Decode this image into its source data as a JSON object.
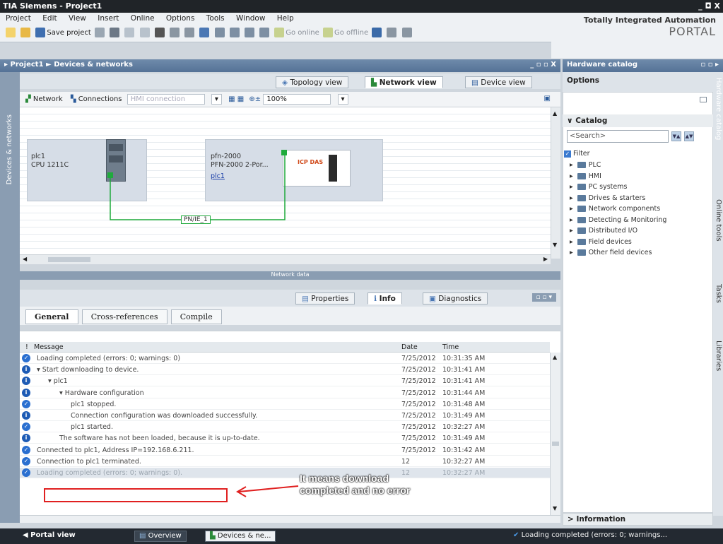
{
  "window": {
    "title": "Siemens - Project1",
    "controls": "_ ◘ X"
  },
  "menu": [
    "Project",
    "Edit",
    "View",
    "Insert",
    "Online",
    "Options",
    "Tools",
    "Window",
    "Help"
  ],
  "toolbar": {
    "save_label": "Save project",
    "go_online": "Go online",
    "go_offline": "Go offline"
  },
  "brand": {
    "line1": "Totally Integrated Automation",
    "line2": "PORTAL"
  },
  "breadcrumb": {
    "project": "Project1",
    "separator": "►",
    "section": "Devices & networks"
  },
  "left_strip_label": "Devices & networks",
  "view_tabs": {
    "topology": "Topology view",
    "network": "Network view",
    "device": "Device view"
  },
  "net_toolbar": {
    "network": "Network",
    "connections": "Connections",
    "hmi_connection": "HMI connection",
    "zoom": "100%"
  },
  "devices": {
    "plc": {
      "name": "plc1",
      "type": "CPU 1211C"
    },
    "pfn": {
      "name": "pfn-2000",
      "type": "PFN-2000 2-Por...",
      "link": "plc1",
      "logo": "ICP DAS"
    },
    "subnet": "PN/IE_1"
  },
  "network_data_label": "Network data",
  "info_tabs": {
    "properties": "Properties",
    "info": "Info",
    "diagnostics": "Diagnostics"
  },
  "sub_tabs": {
    "general": "General",
    "crossref": "Cross-references",
    "compile": "Compile"
  },
  "messages": {
    "headers": {
      "message": "Message",
      "date": "Date",
      "time": "Time"
    },
    "rows": [
      {
        "icon": "check",
        "indent": 0,
        "text": "Loading completed (errors: 0; warnings: 0)",
        "date": "7/25/2012",
        "time": "10:31:35 AM"
      },
      {
        "icon": "info",
        "indent": 0,
        "text": "▾ Start downloading to device.",
        "date": "7/25/2012",
        "time": "10:31:41 AM"
      },
      {
        "icon": "info",
        "indent": 1,
        "text": "▾ plc1",
        "date": "7/25/2012",
        "time": "10:31:41 AM"
      },
      {
        "icon": "info",
        "indent": 2,
        "text": "▾ Hardware configuration",
        "date": "7/25/2012",
        "time": "10:31:44 AM"
      },
      {
        "icon": "check",
        "indent": 3,
        "text": "plc1 stopped.",
        "date": "7/25/2012",
        "time": "10:31:48 AM"
      },
      {
        "icon": "info",
        "indent": 3,
        "text": "Connection configuration was downloaded successfully.",
        "date": "7/25/2012",
        "time": "10:31:49 AM"
      },
      {
        "icon": "check",
        "indent": 3,
        "text": "plc1 started.",
        "date": "7/25/2012",
        "time": "10:32:27 AM"
      },
      {
        "icon": "info",
        "indent": 2,
        "text": "The software has not been loaded, because it is up-to-date.",
        "date": "7/25/2012",
        "time": "10:31:49 AM"
      },
      {
        "icon": "check",
        "indent": 0,
        "text": "Connected to plc1, Address IP=192.168.6.211.",
        "date": "7/25/2012",
        "time": "10:31:42 AM"
      },
      {
        "icon": "check",
        "indent": 0,
        "text": "Connection to plc1 terminated.",
        "date": "12",
        "time": "10:32:27 AM"
      },
      {
        "icon": "check",
        "indent": 0,
        "text": "Loading completed (errors: 0; warnings: 0).",
        "date": "12",
        "time": "10:32:27 AM",
        "selected": true
      }
    ]
  },
  "annotation": {
    "line1": "It means download",
    "line2": "completed and no error"
  },
  "hw_catalog": {
    "title": "Hardware catalog",
    "options": "Options",
    "catalog": "Catalog",
    "search_placeholder": "<Search>",
    "filter": "Filter",
    "items": [
      "PLC",
      "HMI",
      "PC systems",
      "Drives & starters",
      "Network components",
      "Detecting & Monitoring",
      "Distributed I/O",
      "Field devices",
      "Other field devices"
    ],
    "information": "Information"
  },
  "right_tabs": [
    "Hardware catalog",
    "Online tools",
    "Tasks",
    "Libraries"
  ],
  "status_bar": {
    "portal_view": "Portal view",
    "overview": "Overview",
    "devices_tab": "Devices & ne...",
    "status": "Loading completed (errors: 0; warnings..."
  },
  "colors": {
    "accent": "#557296",
    "check": "#2a6fd0",
    "info": "#1d5bb5",
    "green": "#1faa3c",
    "annotation_red": "#e02020"
  }
}
